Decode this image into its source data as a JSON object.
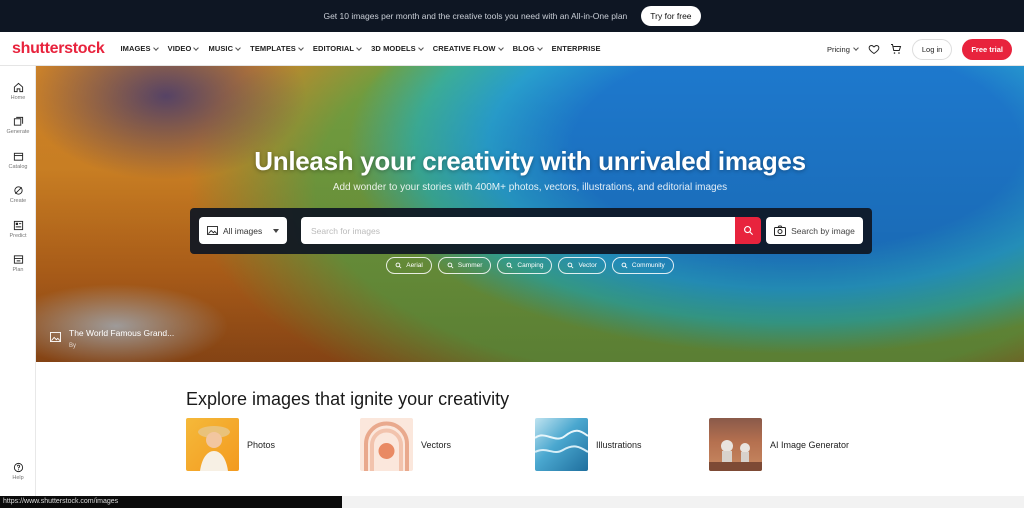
{
  "promo": {
    "text": "Get 10 images per month and the creative tools you need with an All-in-One plan",
    "cta": "Try for free"
  },
  "brand": {
    "logo": "shutterstock",
    "color": "#e8233d"
  },
  "nav": {
    "items": [
      "IMAGES",
      "VIDEO",
      "MUSIC",
      "TEMPLATES",
      "EDITORIAL",
      "3D MODELS",
      "CREATIVE FLOW",
      "BLOG",
      "ENTERPRISE"
    ],
    "pricing": "Pricing",
    "login": "Log in",
    "free_trial": "Free trial"
  },
  "rail": {
    "items": [
      "Home",
      "Generate",
      "Catalog",
      "Create",
      "Predict",
      "Plan"
    ],
    "help": "Help"
  },
  "hero": {
    "title": "Unleash your creativity with unrivaled images",
    "subtitle": "Add wonder to your stories with 400M+ photos, vectors, illustrations, and editorial images",
    "category": "All images",
    "search_placeholder": "Search for images",
    "image_search": "Search by image",
    "chips": [
      "Aerial",
      "Summer",
      "Camping",
      "Vector",
      "Community"
    ],
    "credit_title": "The World Famous Grand...",
    "credit_by": "By"
  },
  "explore": {
    "title": "Explore images that ignite your creativity",
    "tiles": [
      "Photos",
      "Vectors",
      "Illustrations",
      "AI Image Generator"
    ]
  },
  "status_url": "https://www.shutterstock.com/images"
}
